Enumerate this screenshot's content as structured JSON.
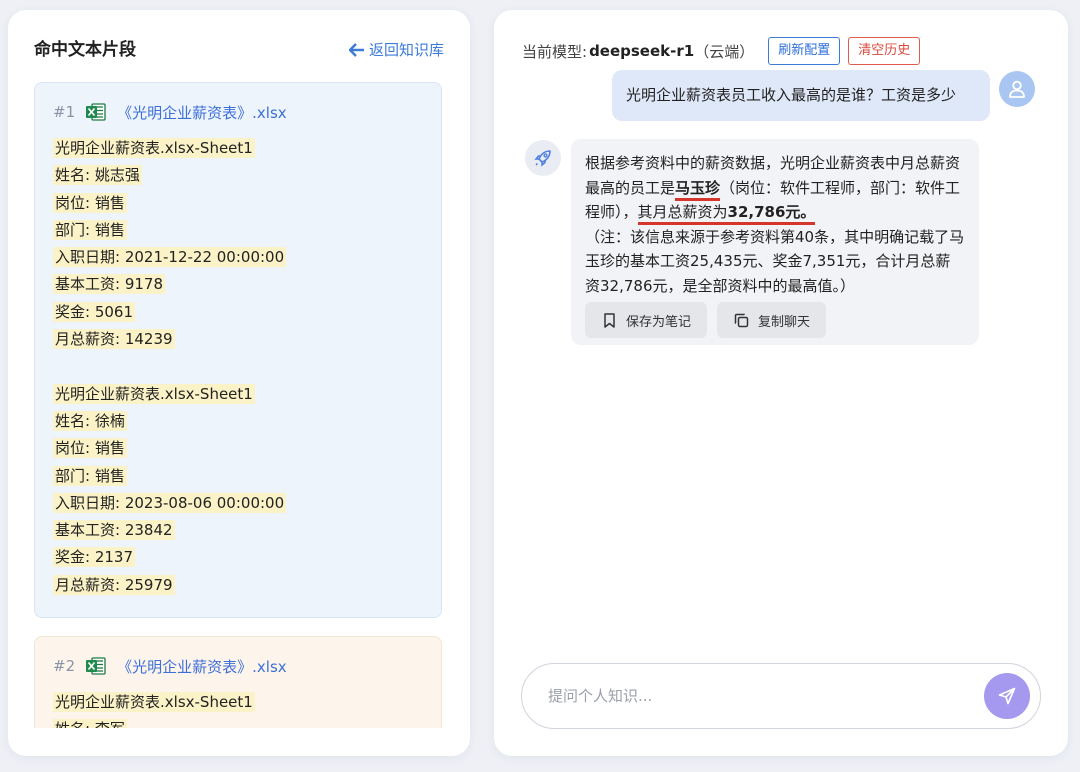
{
  "left_panel": {
    "title": "命中文本片段",
    "back_link": "返回知识库",
    "cards": [
      {
        "num": "#1",
        "file": "《光明企业薪资表》.xlsx",
        "lines": [
          "光明企业薪资表.xlsx-Sheet1",
          "姓名: 姚志强",
          "岗位: 销售",
          "部门: 销售",
          "入职日期: 2021-12-22 00:00:00",
          "基本工资: 9178",
          "奖金: 5061",
          "月总薪资: 14239",
          "",
          "光明企业薪资表.xlsx-Sheet1",
          "姓名: 徐楠",
          "岗位: 销售",
          "部门: 销售",
          "入职日期: 2023-08-06 00:00:00",
          "基本工资: 23842",
          "奖金: 2137",
          "月总薪资: 25979"
        ]
      },
      {
        "num": "#2",
        "file": "《光明企业薪资表》.xlsx",
        "lines": [
          "光明企业薪资表.xlsx-Sheet1",
          "姓名: 李军"
        ]
      }
    ]
  },
  "right_panel": {
    "model_label": "当前模型:",
    "model_name": "deepseek-r1",
    "model_suffix": "（云端）",
    "refresh_button": "刷新配置",
    "clear_button": "清空历史",
    "user_message": "光明企业薪资表员工收入最高的是谁？工资是多少",
    "bot_message": {
      "p1": "根据参考资料中的薪资数据，光明企业薪资表中月总薪资最高的员工是",
      "name": "马玉珍",
      "p2": "（岗位：软件工程师，部门：软件工程师），",
      "p3": "其月总薪资为",
      "amount": "32,786元。",
      "p4": "（注：该信息来源于参考资料第40条，其中明确记载了马玉珍的基本工资25,435元、奖金7,351元，合计月总薪资32,786元，是全部资料中的最高值。）"
    },
    "save_note_button": "保存为笔记",
    "copy_chat_button": "复制聊天",
    "input_placeholder": "提问个人知识..."
  },
  "colors": {
    "accent": "#3d7bd8",
    "danger": "#d84a3d",
    "send_button": "#a598ef",
    "highlight": "#fbf3c7",
    "underline": "#d4362b"
  }
}
